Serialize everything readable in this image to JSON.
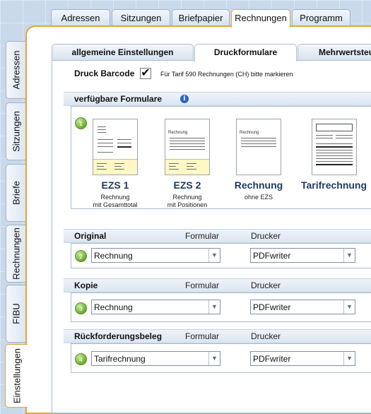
{
  "top_tabs": [
    {
      "label": "Adressen"
    },
    {
      "label": "Sitzungen"
    },
    {
      "label": "Briefpapier"
    },
    {
      "label": "Rechnungen",
      "active": true
    },
    {
      "label": "Programm"
    }
  ],
  "side_tabs": [
    {
      "label": "Adressen"
    },
    {
      "label": "Sitzungen"
    },
    {
      "label": "Briefe"
    },
    {
      "label": "Rechnungen"
    },
    {
      "label": "FIBU"
    },
    {
      "label": "Einstellungen",
      "active": true
    }
  ],
  "inner_tabs": [
    {
      "label": "allgemeine Einstellungen"
    },
    {
      "label": "Druckformulare",
      "active": true
    },
    {
      "label": "Mehrwertsteu"
    }
  ],
  "barcode": {
    "label": "Druck Barcode",
    "checked_mark": "✔",
    "hint": "Für Tarif 590 Rechnungen (CH) bitte markieren"
  },
  "formulare": {
    "title": "verfügbare Formulare",
    "info_icon": "i",
    "step_number": "1",
    "items": [
      {
        "title": "EZS 1",
        "sub1": "Rechnung",
        "sub2": "mit Gesamttotal"
      },
      {
        "title": "EZS 2",
        "sub1": "Rechnung",
        "sub2": "mit Positionen",
        "thumb_text": "Rechnung"
      },
      {
        "title": "Rechnung",
        "sub1": "ohne EZS",
        "sub2": "",
        "thumb_text": "Rechnung"
      },
      {
        "title": "Tarifrechnung",
        "sub1": "",
        "sub2": ""
      }
    ]
  },
  "sections": [
    {
      "title": "Original",
      "col_formular": "Formular",
      "col_drucker": "Drucker",
      "step": "2",
      "formular_value": "Rechnung",
      "drucker_value": "PDFwriter"
    },
    {
      "title": "Kopie",
      "col_formular": "Formular",
      "col_drucker": "Drucker",
      "step": "3",
      "formular_value": "Rechnung",
      "drucker_value": "PDFwriter"
    },
    {
      "title": "Rückforderungsbeleg",
      "col_formular": "Formular",
      "col_drucker": "Drucker",
      "step": "4",
      "formular_value": "Tarifrechnung",
      "drucker_value": "PDFwriter"
    }
  ],
  "dropdown_arrow": "▼",
  "colors": {
    "accent": "#e3a43b",
    "step_green": "#6eaa2f",
    "info_blue": "#2a64c8",
    "header_text": "#1e3a5c"
  }
}
